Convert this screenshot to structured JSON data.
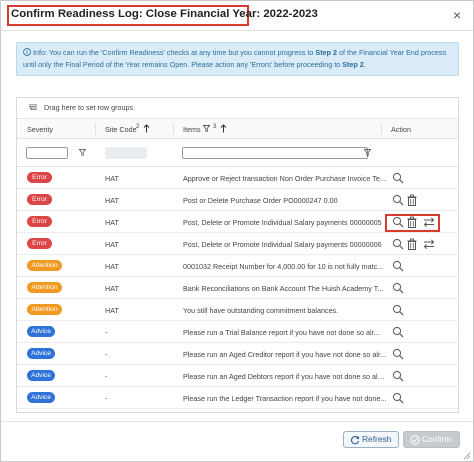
{
  "dialog": {
    "title": "Confirm Readiness Log: Close Financial Year: 2022-2023",
    "close_glyph": "×"
  },
  "info": {
    "line1_pre": "Info: You can run the 'Confirm Readiness' checks at any time but you cannot progress to ",
    "line1_bold": "Step 2",
    "line1_post": " of the Financial Year End process",
    "line2_pre": "until only the Final Period of the Year remains Open. Please action any 'Errors' before proceeding to ",
    "line2_bold": "Step 2",
    "line2_post": "."
  },
  "grid": {
    "group_hint": "Drag here to set row groups",
    "columns": {
      "severity": "Severity",
      "site_code": "Site Code",
      "site_code_sort_index": "2",
      "items": "Items",
      "items_sort_index": "3",
      "action": "Action"
    },
    "rows": [
      {
        "severity": "Error",
        "kind": "error",
        "site": "HAT",
        "item": "Approve or Reject transaction Non Order Purchase Invoice Te...",
        "actions": [
          "view"
        ]
      },
      {
        "severity": "Error",
        "kind": "error",
        "site": "HAT",
        "item": "Post or Delete Purchase Order PO0000247 0.00",
        "actions": [
          "view",
          "delete"
        ]
      },
      {
        "severity": "Error",
        "kind": "error",
        "site": "HAT",
        "item": "Post, Delete or Promote Individual Salary payments 00000005",
        "actions": [
          "view",
          "delete",
          "promote"
        ]
      },
      {
        "severity": "Error",
        "kind": "error",
        "site": "HAT",
        "item": "Post, Delete or Promote Individual Salary payments 00000006",
        "actions": [
          "view",
          "delete",
          "promote"
        ]
      },
      {
        "severity": "Attention",
        "kind": "attention",
        "site": "HAT",
        "item": "0001032 Receipt Number for 4,000.00 for 10 is not fully matc...",
        "actions": [
          "view"
        ]
      },
      {
        "severity": "Attention",
        "kind": "attention",
        "site": "HAT",
        "item": "Bank Reconciliations on Bank Account The Huish Academy T...",
        "actions": [
          "view"
        ]
      },
      {
        "severity": "Attention",
        "kind": "attention",
        "site": "HAT",
        "item": "You still have outstanding commitment balances.",
        "actions": [
          "view"
        ]
      },
      {
        "severity": "Advice",
        "kind": "advice",
        "site": "-",
        "item": "Please run a Trial Balance report if you have not done so alr...",
        "actions": [
          "view"
        ]
      },
      {
        "severity": "Advice",
        "kind": "advice",
        "site": "-",
        "item": "Please run an Aged Creditor report if you have not done so alr...",
        "actions": [
          "view"
        ]
      },
      {
        "severity": "Advice",
        "kind": "advice",
        "site": "-",
        "item": "Please run an Aged Debtors report if you have not done so alre...",
        "actions": [
          "view"
        ]
      },
      {
        "severity": "Advice",
        "kind": "advice",
        "site": "-",
        "item": "Please run the Ledger Transaction report if you have not done...",
        "actions": [
          "view"
        ]
      }
    ]
  },
  "footer": {
    "refresh_label": "Refresh",
    "confirm_label": "Confirm"
  },
  "colors": {
    "error": "#dd4646",
    "attention": "#f09a24",
    "advice": "#2f73d8",
    "highlight": "#d83a2b"
  }
}
